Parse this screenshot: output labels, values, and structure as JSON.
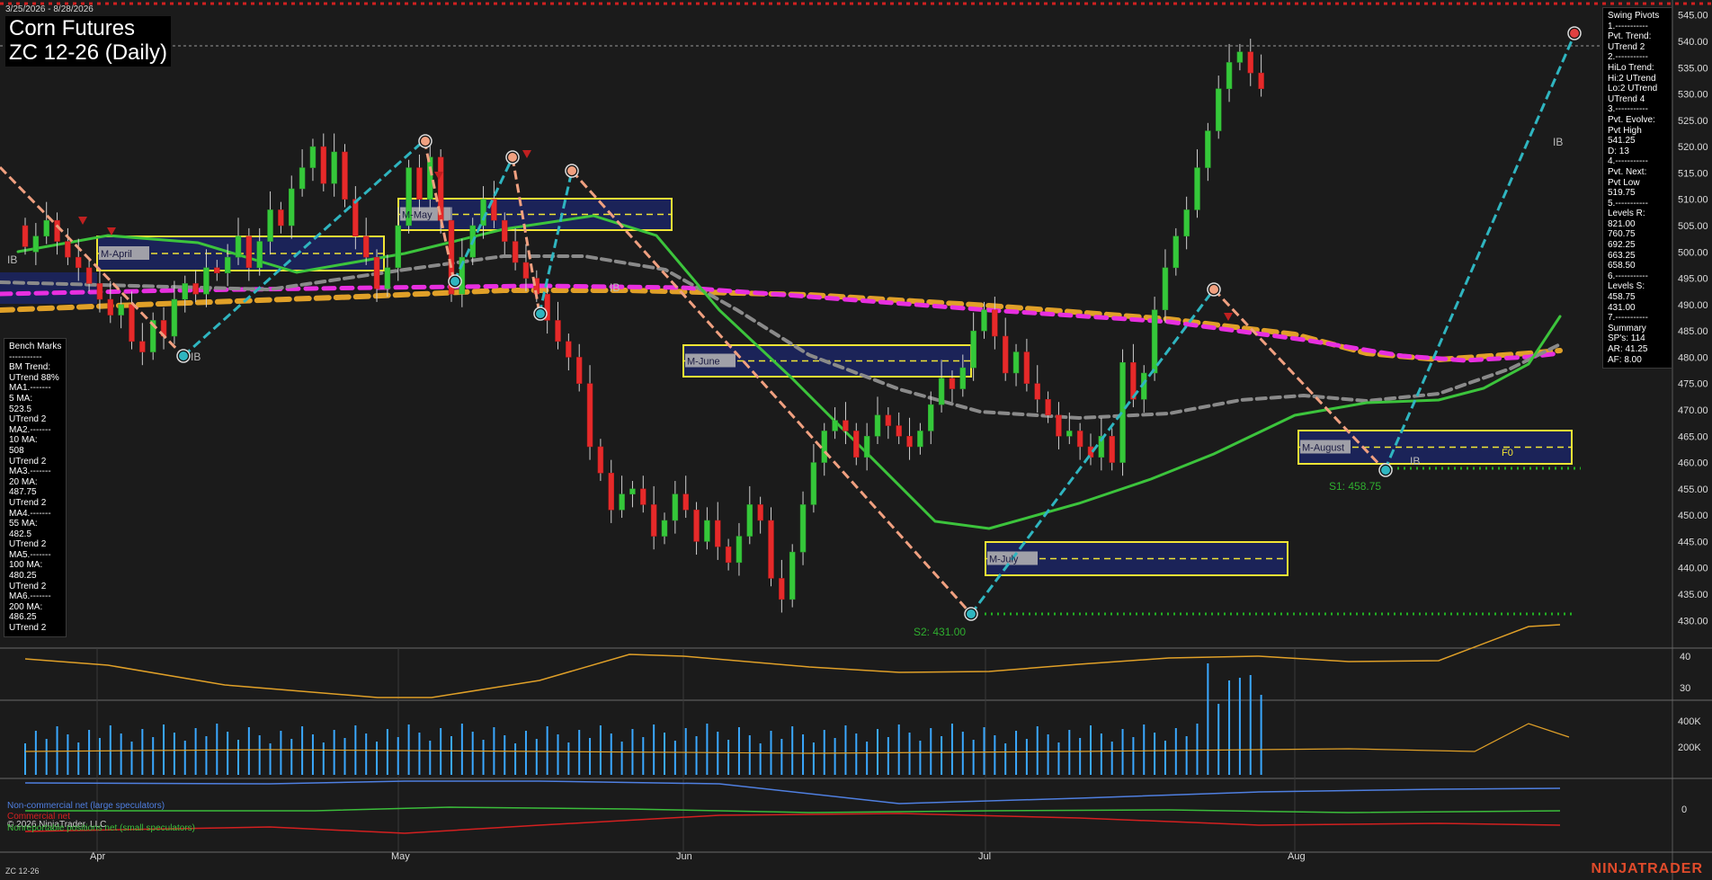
{
  "header": {
    "date_range": "3/25/2026 - 8/28/2026",
    "title_line1": "Corn Futures",
    "title_line2": "ZC 12-26 (Daily)"
  },
  "swing_pivots": [
    "Swing Pivots",
    "1.-----------",
    "Pvt. Trend:",
    "UTrend 2",
    "2.-----------",
    "HiLo Trend:",
    "Hi:2 UTrend",
    "Lo:2 UTrend",
    "UTrend 4",
    "3.-----------",
    "Pvt. Evolve:",
    "Pvt High",
    "541.25",
    "D: 13",
    "4.-----------",
    "Pvt. Next:",
    "Pvt Low",
    "519.75",
    "5.-----------",
    "Levels R:",
    "821.00",
    "760.75",
    "692.25",
    "663.25",
    "658.50",
    "6.-----------",
    "Levels S:",
    "458.75",
    "431.00",
    "7.-----------",
    "Summary",
    "SP's: 114",
    "AR: 41.25",
    "AF: 8.00"
  ],
  "bench_marks": [
    "Bench Marks",
    "-----------",
    "BM Trend:",
    "UTrend 88%",
    "MA1.-------",
    "5 MA:",
    "523.5",
    "UTrend 2",
    "MA2.-------",
    "10 MA:",
    "508",
    "UTrend 2",
    "MA3.-------",
    "20 MA:",
    "487.75",
    "UTrend 2",
    "MA4.-------",
    "55 MA:",
    "482.5",
    "UTrend 2",
    "MA5.-------",
    "100 MA:",
    "480.25",
    "UTrend 2",
    "MA6.-------",
    "200 MA:",
    "486.25",
    "UTrend 2"
  ],
  "price_axis": [
    "545.00",
    "540.00",
    "535.00",
    "530.00",
    "525.00",
    "520.00",
    "515.00",
    "510.00",
    "505.00",
    "500.00",
    "495.00",
    "490.00",
    "485.00",
    "480.00",
    "475.00",
    "470.00",
    "465.00",
    "460.00",
    "455.00",
    "450.00",
    "445.00",
    "440.00",
    "435.00",
    "430.00"
  ],
  "indicator_axis": [
    "40",
    "30"
  ],
  "volume_axis": [
    "400K",
    "200K"
  ],
  "cot_axis": [
    "0"
  ],
  "month_labels": [
    "Apr",
    "May",
    "Jun",
    "Jul",
    "Aug"
  ],
  "box_labels": [
    "M-April",
    "M-May",
    "M-June",
    "M-July",
    "M-August"
  ],
  "support_labels": {
    "s1": "S1: 458.75",
    "s2": "S2: 431.00"
  },
  "markers": {
    "ib": "IB",
    "f0": "F0"
  },
  "cot_legend": {
    "noncommercial": "Non-commercial net (large speculators)",
    "commercial": "Commercial net",
    "nonreportable": "Nonreportable positions net (small speculators)",
    "copyright": "© 2026 NinjaTrader, LLC"
  },
  "footer": {
    "symbol": "ZC 12-26",
    "brand": "NINJATRADER"
  },
  "colors": {
    "background": "#1b1b1b",
    "up_candle": "#35c83a",
    "down_candle": "#e62a2a",
    "ma_green": "#3cc43c",
    "ma_gray": "#8a8a8a",
    "ma_magenta": "#e82fe0",
    "ma_orange": "#e0a028",
    "swing_up": "#2fb5c0",
    "swing_down": "#f0a080",
    "box_fill": "#1b2358",
    "box_border": "#f2e535",
    "noncommercial": "#4f7fe0",
    "commercial": "#d42020",
    "nonreportable": "#3bbd3b"
  }
}
